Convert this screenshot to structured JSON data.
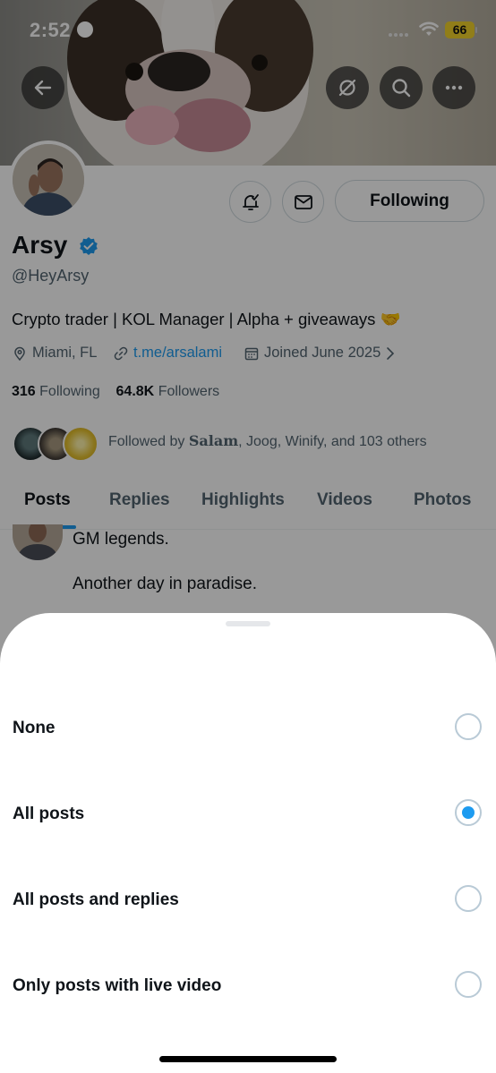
{
  "status_bar": {
    "time": "2:52",
    "battery": "66"
  },
  "profile": {
    "name": "Arsy",
    "handle": "@HeyArsy",
    "bio": "Crypto trader | KOL Manager | Alpha + giveaways 🤝",
    "location": "Miami, FL",
    "link": "t.me/arsalami",
    "joined": "Joined June 2025",
    "following_count": "316",
    "following_label": "Following",
    "followers_count": "64.8K",
    "followers_label": "Followers",
    "followed_by_prefix": "Followed by",
    "followed_by_first": "Salam",
    "followed_by_rest": ", Joog, Winify, and 103 others",
    "follow_button": "Following"
  },
  "tabs": [
    {
      "label": "Posts"
    },
    {
      "label": "Replies"
    },
    {
      "label": "Highlights"
    },
    {
      "label": "Videos"
    },
    {
      "label": "Photos"
    }
  ],
  "tweet": {
    "line1": "GM legends.",
    "line2": "Another day in paradise."
  },
  "sheet": {
    "options": [
      {
        "label": "None",
        "selected": false
      },
      {
        "label": "All posts",
        "selected": true
      },
      {
        "label": "All posts and replies",
        "selected": false
      },
      {
        "label": "Only posts with live video",
        "selected": false
      }
    ]
  },
  "colors": {
    "accent": "#1d9bf0",
    "text": "#0f1419",
    "secondary_text": "#536471",
    "battery": "#f2d22b"
  },
  "icons": [
    "back-arrow-icon",
    "no-image-icon",
    "search-icon",
    "more-icon",
    "notification-bell-icon",
    "mail-icon",
    "verified-badge-icon",
    "location-pin-icon",
    "link-icon",
    "calendar-icon",
    "chevron-right-icon"
  ]
}
